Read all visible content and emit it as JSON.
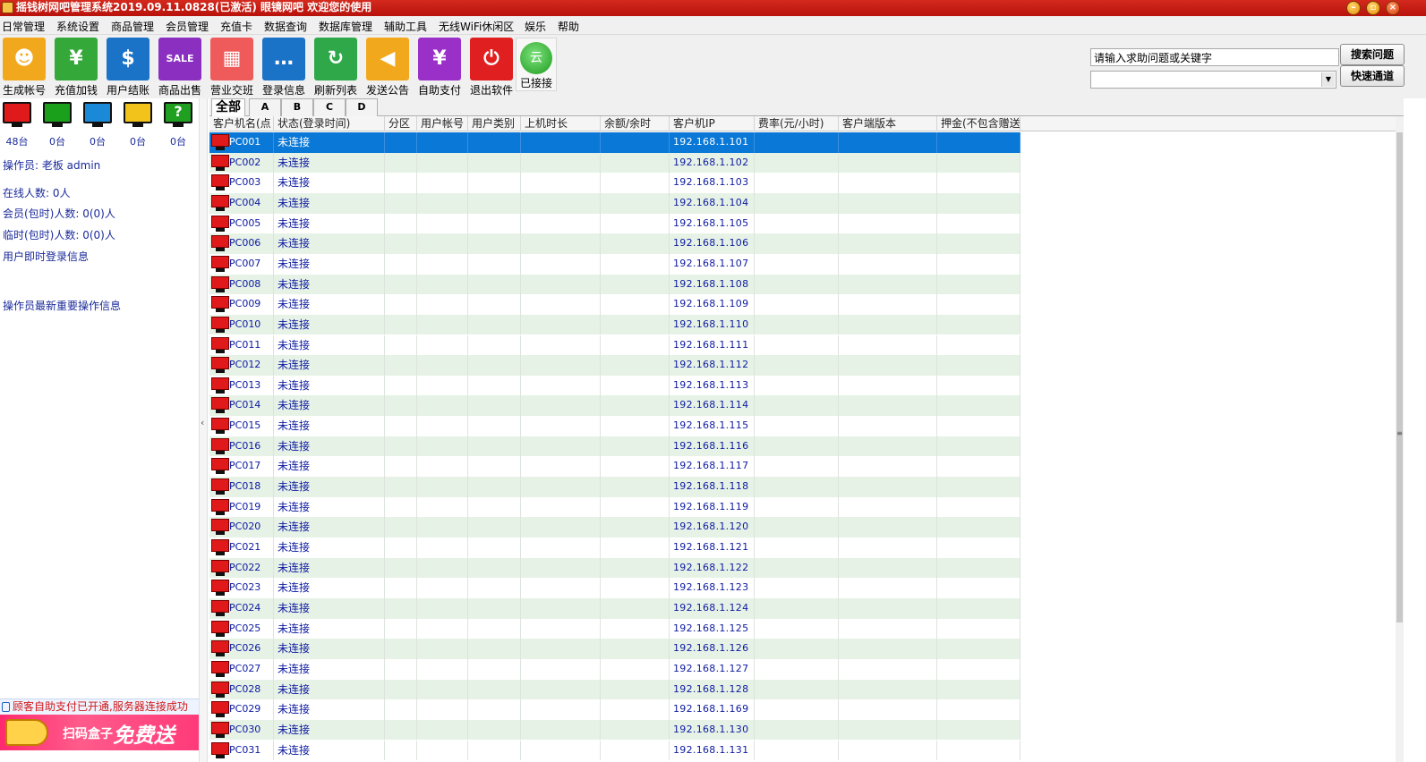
{
  "window": {
    "title": "摇钱树网吧管理系统2019.09.11.0828(已激活)  眼镜网吧 欢迎您的使用",
    "minimize_glyph": "–",
    "maximize_glyph": "▫",
    "close_glyph": "×"
  },
  "menu": [
    "日常管理",
    "系统设置",
    "商品管理",
    "会员管理",
    "充值卡",
    "数据查询",
    "数据库管理",
    "辅助工具",
    "无线WiFi休闲区",
    "娱乐",
    "帮助"
  ],
  "toolbar": [
    {
      "label": "生成帐号",
      "icon": "user-icon",
      "color": "#f2a81c"
    },
    {
      "label": "充值加钱",
      "icon": "money-bag-icon",
      "color": "#35a83a"
    },
    {
      "label": "用户结账",
      "icon": "bill-icon",
      "color": "#1b73c7"
    },
    {
      "label": "商品出售",
      "icon": "tag-icon",
      "color": "#8b2fc1"
    },
    {
      "label": "营业交班",
      "icon": "store-icon",
      "color": "#ef5a5a"
    },
    {
      "label": "登录信息",
      "icon": "message-icon",
      "color": "#1b73c7"
    },
    {
      "label": "刷新列表",
      "icon": "refresh-icon",
      "color": "#2fa84a"
    },
    {
      "label": "发送公告",
      "icon": "megaphone-icon",
      "color": "#f2a81c"
    },
    {
      "label": "自助支付",
      "icon": "yen-icon",
      "color": "#9b30c8"
    },
    {
      "label": "退出软件",
      "icon": "power-icon",
      "color": "#e02020"
    }
  ],
  "toolbar_glyphs": [
    "☻",
    "¥",
    "$",
    "SALE",
    "▦",
    "…",
    "↻",
    "◀",
    "¥",
    "⏻"
  ],
  "connection": {
    "label": "已接接",
    "icon_text": "云"
  },
  "search": {
    "placeholder": "请输入求助问题或关键字",
    "search_button": "搜索问题",
    "quick_button": "快速通道"
  },
  "status_monitors": [
    {
      "color": "#e01a1a",
      "count": "48台"
    },
    {
      "color": "#1aa01a",
      "count": "0台"
    },
    {
      "color": "#1a8ad8",
      "count": "0台"
    },
    {
      "color": "#f2c31a",
      "count": "0台"
    },
    {
      "color": "#20a020",
      "count": "0台",
      "glyph": "?"
    }
  ],
  "left_panel": {
    "operator": "操作员:  老板 admin",
    "online": "在线人数: 0人",
    "member": "会员(包时)人数: 0(0)人",
    "temp": "临时(包时)人数: 0(0)人",
    "user_login_info": "用户即时登录信息",
    "operator_info": "操作员最新重要操作信息",
    "notice": "顾客自助支付已开通,服务器连接成功",
    "banner_text1": "扫码盒子",
    "banner_text2": "免费送啦!",
    "collapse_glyph": "‹"
  },
  "tabs": [
    "全部",
    "A",
    "B",
    "C",
    "D"
  ],
  "columns": [
    "客户机名(点",
    "状态(登录时间)",
    "分区",
    "用户帐号",
    "用户类别",
    "上机时长",
    "余额/余时",
    "客户机IP",
    "费率(元/小时)",
    "客户端版本",
    "押金(不包含赠送"
  ],
  "status_text": "未连接",
  "rows": [
    {
      "name": "PC001",
      "ip": "192.168.1.101"
    },
    {
      "name": "PC002",
      "ip": "192.168.1.102"
    },
    {
      "name": "PC003",
      "ip": "192.168.1.103"
    },
    {
      "name": "PC004",
      "ip": "192.168.1.104"
    },
    {
      "name": "PC005",
      "ip": "192.168.1.105"
    },
    {
      "name": "PC006",
      "ip": "192.168.1.106"
    },
    {
      "name": "PC007",
      "ip": "192.168.1.107"
    },
    {
      "name": "PC008",
      "ip": "192.168.1.108"
    },
    {
      "name": "PC009",
      "ip": "192.168.1.109"
    },
    {
      "name": "PC010",
      "ip": "192.168.1.110"
    },
    {
      "name": "PC011",
      "ip": "192.168.1.111"
    },
    {
      "name": "PC012",
      "ip": "192.168.1.112"
    },
    {
      "name": "PC013",
      "ip": "192.168.1.113"
    },
    {
      "name": "PC014",
      "ip": "192.168.1.114"
    },
    {
      "name": "PC015",
      "ip": "192.168.1.115"
    },
    {
      "name": "PC016",
      "ip": "192.168.1.116"
    },
    {
      "name": "PC017",
      "ip": "192.168.1.117"
    },
    {
      "name": "PC018",
      "ip": "192.168.1.118"
    },
    {
      "name": "PC019",
      "ip": "192.168.1.119"
    },
    {
      "name": "PC020",
      "ip": "192.168.1.120"
    },
    {
      "name": "PC021",
      "ip": "192.168.1.121"
    },
    {
      "name": "PC022",
      "ip": "192.168.1.122"
    },
    {
      "name": "PC023",
      "ip": "192.168.1.123"
    },
    {
      "name": "PC024",
      "ip": "192.168.1.124"
    },
    {
      "name": "PC025",
      "ip": "192.168.1.125"
    },
    {
      "name": "PC026",
      "ip": "192.168.1.126"
    },
    {
      "name": "PC027",
      "ip": "192.168.1.127"
    },
    {
      "name": "PC028",
      "ip": "192.168.1.128"
    },
    {
      "name": "PC029",
      "ip": "192.168.1.169"
    },
    {
      "name": "PC030",
      "ip": "192.168.1.130"
    },
    {
      "name": "PC031",
      "ip": "192.168.1.131"
    }
  ],
  "selected_row": "PC001"
}
